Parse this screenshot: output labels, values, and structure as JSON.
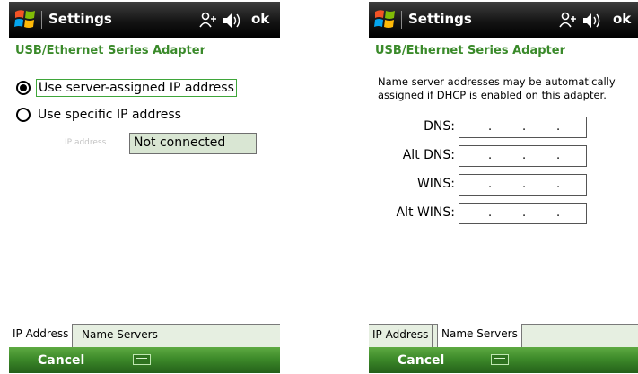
{
  "left_screen": {
    "titlebar": {
      "title": "Settings",
      "ok_label": "ok"
    },
    "subtitle": "USB/Ethernet Series Adapter",
    "options": [
      {
        "label": "Use server-assigned IP address",
        "selected": true
      },
      {
        "label": "Use specific IP address",
        "selected": false
      }
    ],
    "ip_address": {
      "label": "IP address",
      "value": "Not connected"
    },
    "tabs": [
      {
        "label": "IP Address",
        "active": true
      },
      {
        "label": "Name Servers",
        "active": false
      }
    ],
    "menubar": {
      "left_softkey": "Cancel",
      "center_icon": "keyboard-icon"
    }
  },
  "right_screen": {
    "titlebar": {
      "title": "Settings",
      "ok_label": "ok"
    },
    "subtitle": "USB/Ethernet Series Adapter",
    "info_text": "Name server addresses may be automatically assigned if DHCP is enabled on this adapter.",
    "fields": [
      {
        "label": "DNS:",
        "value": " .  .  . "
      },
      {
        "label": "Alt DNS:",
        "value": " .  .  . "
      },
      {
        "label": "WINS:",
        "value": " .  .  . "
      },
      {
        "label": "Alt WINS:",
        "value": " .  .  . "
      }
    ],
    "tabs": [
      {
        "label": "IP Address",
        "active": false
      },
      {
        "label": "Name Servers",
        "active": true
      }
    ],
    "menubar": {
      "left_softkey": "Cancel",
      "center_icon": "keyboard-icon"
    }
  },
  "colors": {
    "title_bar": "#141414",
    "subtitle_text": "#3a8a2a",
    "menu_bar": "#3d8a2a",
    "focus_border": "#3fa63a",
    "ip_field_bg": "#d9e6d3"
  }
}
